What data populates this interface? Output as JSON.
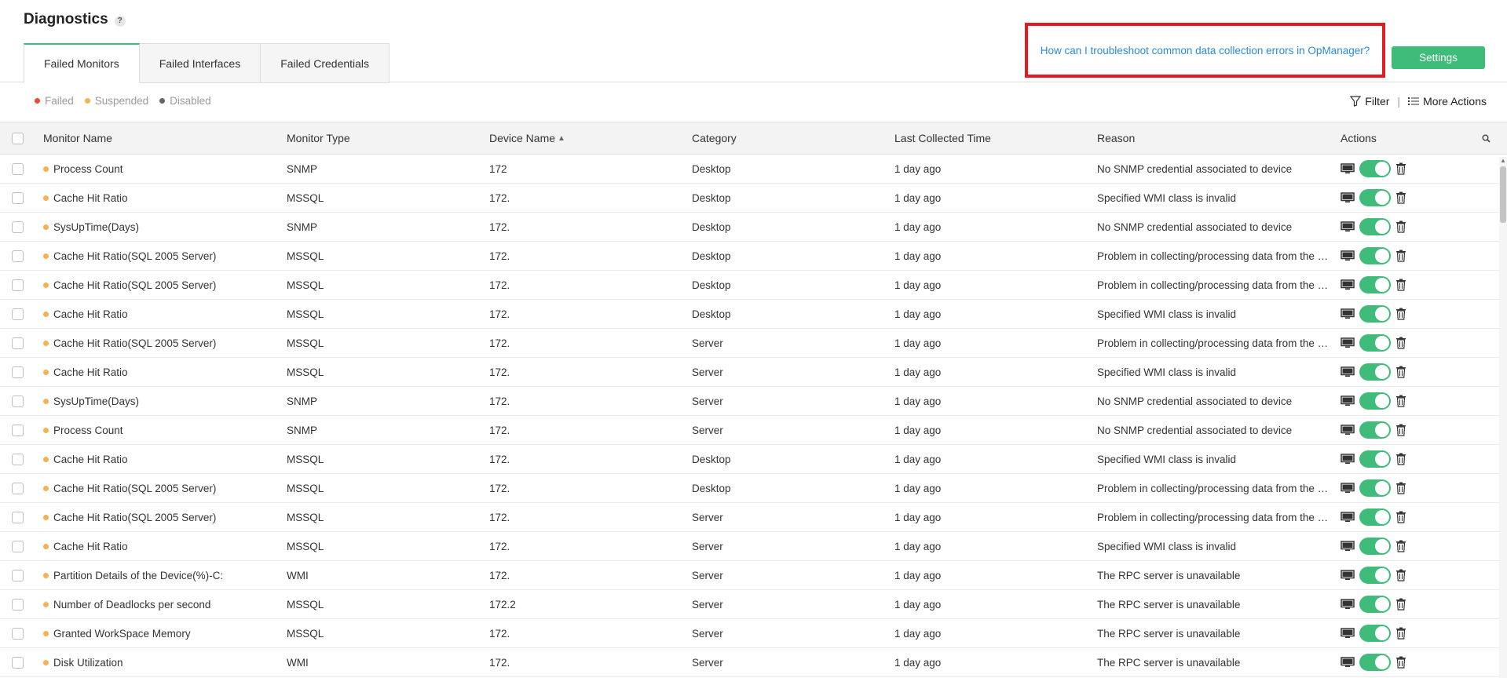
{
  "header": {
    "title": "Diagnostics",
    "help_icon": "question-circle-icon"
  },
  "tabs": [
    {
      "label": "Failed Monitors",
      "active": true
    },
    {
      "label": "Failed Interfaces",
      "active": false
    },
    {
      "label": "Failed Credentials",
      "active": false
    }
  ],
  "help_link": "How can I troubleshoot common data collection errors in OpManager?",
  "settings_label": "Settings",
  "legend": [
    {
      "label": "Failed",
      "color": "#e74c3c"
    },
    {
      "label": "Suspended",
      "color": "#f4b253"
    },
    {
      "label": "Disabled",
      "color": "#666666"
    }
  ],
  "toolbar": {
    "filter_label": "Filter",
    "more_actions_label": "More Actions"
  },
  "columns": {
    "name": "Monitor Name",
    "type": "Monitor Type",
    "device": "Device Name",
    "category": "Category",
    "time": "Last Collected Time",
    "reason": "Reason",
    "actions": "Actions"
  },
  "rows": [
    {
      "name": "Process Count",
      "type": "SNMP",
      "device": "172",
      "category": "Desktop",
      "time": "1 day ago",
      "reason": "No SNMP credential associated to device"
    },
    {
      "name": "Cache Hit Ratio",
      "type": "MSSQL",
      "device": "172.",
      "category": "Desktop",
      "time": "1 day ago",
      "reason": "Specified WMI class is invalid"
    },
    {
      "name": "SysUpTime(Days)",
      "type": "SNMP",
      "device": "172.",
      "category": "Desktop",
      "time": "1 day ago",
      "reason": "No SNMP credential associated to device"
    },
    {
      "name": "Cache Hit Ratio(SQL 2005 Server)",
      "type": "MSSQL",
      "device": "172.",
      "category": "Desktop",
      "time": "1 day ago",
      "reason": "Problem in collecting/processing data from the de..."
    },
    {
      "name": "Cache Hit Ratio(SQL 2005 Server)",
      "type": "MSSQL",
      "device": "172.",
      "category": "Desktop",
      "time": "1 day ago",
      "reason": "Problem in collecting/processing data from the de..."
    },
    {
      "name": "Cache Hit Ratio",
      "type": "MSSQL",
      "device": "172.",
      "category": "Desktop",
      "time": "1 day ago",
      "reason": "Specified WMI class is invalid"
    },
    {
      "name": "Cache Hit Ratio(SQL 2005 Server)",
      "type": "MSSQL",
      "device": "172.",
      "category": "Server",
      "time": "1 day ago",
      "reason": "Problem in collecting/processing data from the de..."
    },
    {
      "name": "Cache Hit Ratio",
      "type": "MSSQL",
      "device": "172.",
      "category": "Server",
      "time": "1 day ago",
      "reason": "Specified WMI class is invalid"
    },
    {
      "name": "SysUpTime(Days)",
      "type": "SNMP",
      "device": "172.",
      "category": "Server",
      "time": "1 day ago",
      "reason": "No SNMP credential associated to device"
    },
    {
      "name": "Process Count",
      "type": "SNMP",
      "device": "172.",
      "category": "Server",
      "time": "1 day ago",
      "reason": "No SNMP credential associated to device"
    },
    {
      "name": "Cache Hit Ratio",
      "type": "MSSQL",
      "device": "172.",
      "category": "Desktop",
      "time": "1 day ago",
      "reason": "Specified WMI class is invalid"
    },
    {
      "name": "Cache Hit Ratio(SQL 2005 Server)",
      "type": "MSSQL",
      "device": "172.",
      "category": "Desktop",
      "time": "1 day ago",
      "reason": "Problem in collecting/processing data from the de..."
    },
    {
      "name": "Cache Hit Ratio(SQL 2005 Server)",
      "type": "MSSQL",
      "device": "172.",
      "category": "Server",
      "time": "1 day ago",
      "reason": "Problem in collecting/processing data from the de..."
    },
    {
      "name": "Cache Hit Ratio",
      "type": "MSSQL",
      "device": "172.",
      "category": "Server",
      "time": "1 day ago",
      "reason": "Specified WMI class is invalid"
    },
    {
      "name": "Partition Details of the Device(%)-C:",
      "type": "WMI",
      "device": "172.",
      "category": "Server",
      "time": "1 day ago",
      "reason": "The RPC server is unavailable"
    },
    {
      "name": "Number of Deadlocks per second",
      "type": "MSSQL",
      "device": "172.2",
      "category": "Server",
      "time": "1 day ago",
      "reason": "The RPC server is unavailable"
    },
    {
      "name": "Granted WorkSpace Memory",
      "type": "MSSQL",
      "device": "172.",
      "category": "Server",
      "time": "1 day ago",
      "reason": "The RPC server is unavailable"
    },
    {
      "name": "Disk Utilization",
      "type": "WMI",
      "device": "172.",
      "category": "Server",
      "time": "1 day ago",
      "reason": "The RPC server is unavailable"
    }
  ]
}
